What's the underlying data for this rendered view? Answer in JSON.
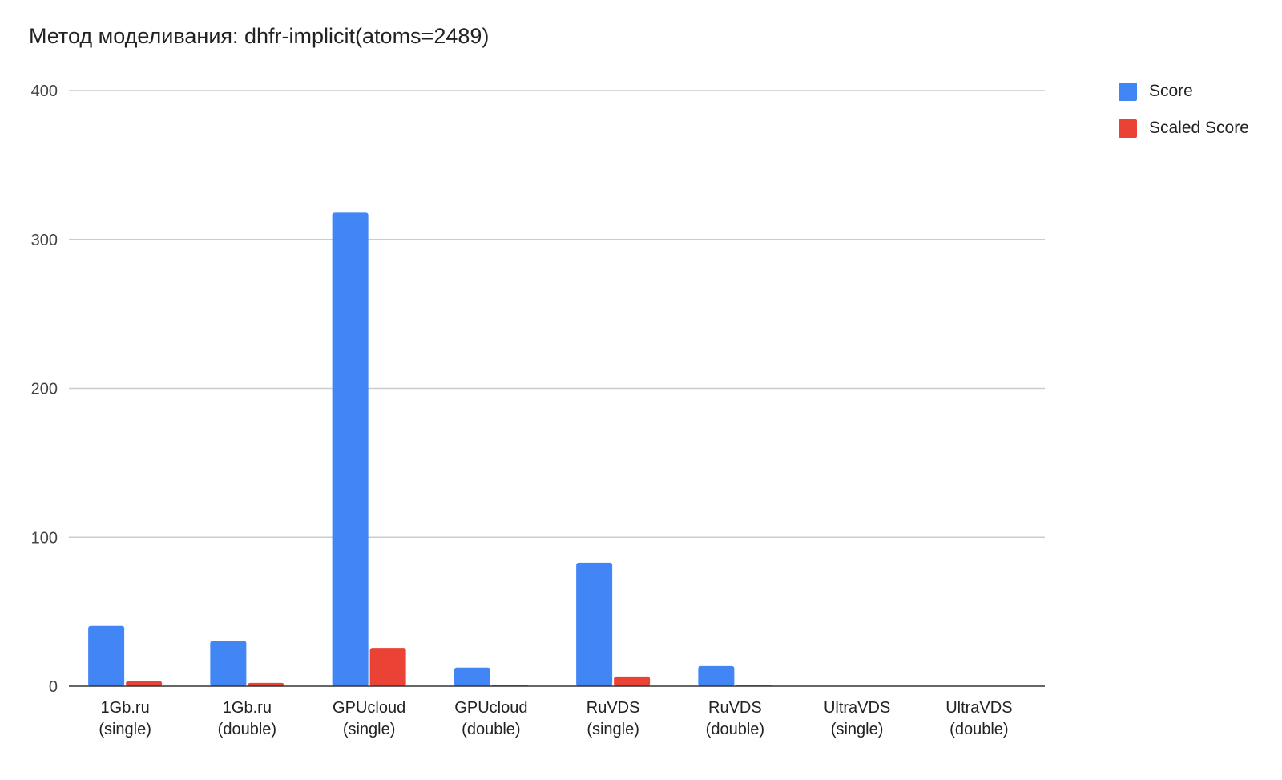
{
  "chart_data": {
    "type": "bar",
    "title": "Метод моделивания: dhfr-implicit(atoms=2489)",
    "xlabel": "",
    "ylabel": "",
    "ylim": [
      0,
      400
    ],
    "yticks": [
      0,
      100,
      200,
      300,
      400
    ],
    "grid": true,
    "legend_position": "top-right",
    "categories": [
      [
        "1Gb.ru",
        "(single)"
      ],
      [
        "1Gb.ru",
        "(double)"
      ],
      [
        "GPUcloud",
        "(single)"
      ],
      [
        "GPUcloud",
        "(double)"
      ],
      [
        "RuVDS",
        "(single)"
      ],
      [
        "RuVDS",
        "(double)"
      ],
      [
        "UltraVDS",
        "(single)"
      ],
      [
        "UltraVDS",
        "(double)"
      ]
    ],
    "series": [
      {
        "name": "Score",
        "color": "#4285f4",
        "values": [
          40.5,
          30.5,
          318,
          12.5,
          83,
          13.5,
          0,
          0
        ]
      },
      {
        "name": "Scaled Score",
        "color": "#ea4335",
        "values": [
          3.5,
          2.2,
          25.8,
          0.5,
          6.5,
          0.5,
          0,
          0
        ]
      }
    ]
  }
}
